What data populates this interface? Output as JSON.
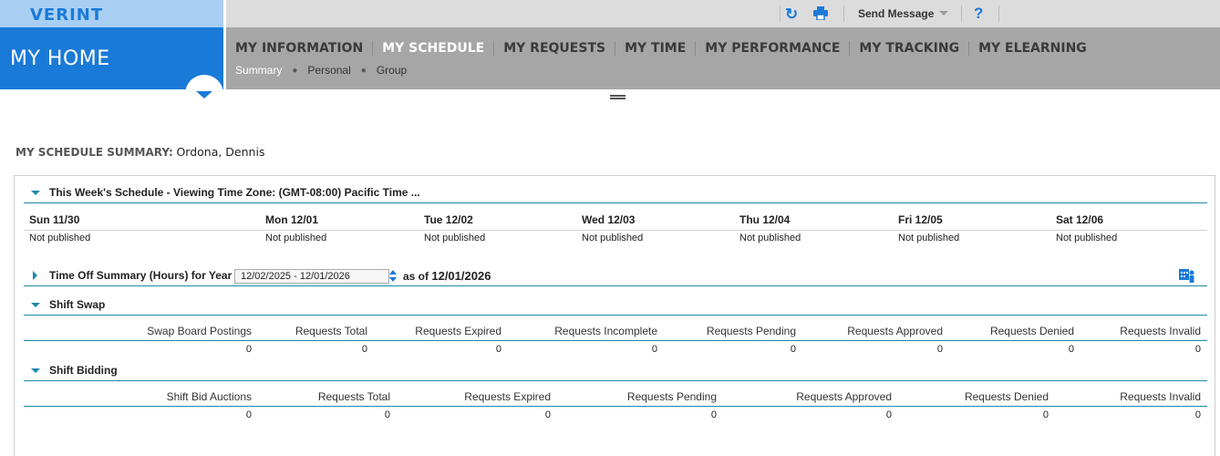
{
  "brand": {
    "logo": "VERINT"
  },
  "home": {
    "title": "MY HOME"
  },
  "utility": {
    "send_message": "Send Message",
    "help": "?"
  },
  "nav": {
    "tabs": [
      {
        "label": "MY INFORMATION"
      },
      {
        "label": "MY SCHEDULE",
        "active": true
      },
      {
        "label": "MY REQUESTS"
      },
      {
        "label": "MY TIME"
      },
      {
        "label": "MY PERFORMANCE"
      },
      {
        "label": "MY TRACKING"
      },
      {
        "label": "MY ELEARNING"
      }
    ],
    "subtabs": [
      {
        "label": "Summary",
        "active": true
      },
      {
        "label": "Personal"
      },
      {
        "label": "Group"
      }
    ]
  },
  "page": {
    "title_label": "MY SCHEDULE SUMMARY:",
    "user_name": "Ordona, Dennis"
  },
  "week": {
    "header": "This Week's Schedule - Viewing Time Zone: (GMT-08:00) Pacific Time ...",
    "days": [
      {
        "label": "Sun 11/30",
        "status": "Not published"
      },
      {
        "label": "Mon 12/01",
        "status": "Not published"
      },
      {
        "label": "Tue 12/02",
        "status": "Not published"
      },
      {
        "label": "Wed 12/03",
        "status": "Not published"
      },
      {
        "label": "Thu 12/04",
        "status": "Not published"
      },
      {
        "label": "Fri 12/05",
        "status": "Not published"
      },
      {
        "label": "Sat 12/06",
        "status": "Not published"
      }
    ]
  },
  "timeoff": {
    "header": "Time Off Summary (Hours) for Year",
    "date_range": "12/02/2025 - 12/01/2026",
    "as_of_label": "as of",
    "as_of_date": "12/01/2026"
  },
  "shift_swap": {
    "header": "Shift Swap",
    "columns": [
      "Swap Board Postings",
      "Requests Total",
      "Requests Expired",
      "Requests Incomplete",
      "Requests Pending",
      "Requests Approved",
      "Requests Denied",
      "Requests Invalid"
    ],
    "values": [
      "0",
      "0",
      "0",
      "0",
      "0",
      "0",
      "0",
      "0"
    ]
  },
  "shift_bidding": {
    "header": "Shift Bidding",
    "columns": [
      "Shift Bid Auctions",
      "Requests Total",
      "Requests Expired",
      "Requests Pending",
      "Requests Approved",
      "Requests Denied",
      "Requests Invalid"
    ],
    "values": [
      "0",
      "0",
      "0",
      "0",
      "0",
      "0",
      "0"
    ]
  },
  "colors": {
    "brand_blue": "#1a7ad8",
    "light_blue": "#a8cff2",
    "nav_gray": "#a6a6a6",
    "teal_rule": "#1d8aa8"
  }
}
